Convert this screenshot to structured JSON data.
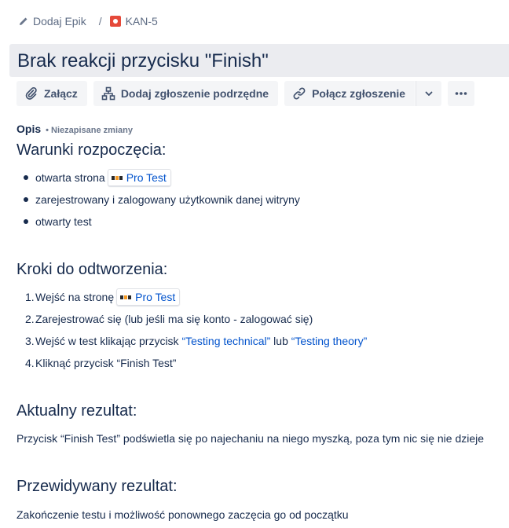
{
  "breadcrumb": {
    "epic_label": "Dodaj Epik",
    "separator": "/",
    "issue_key": "KAN-5"
  },
  "title": "Brak reakcji przycisku \"Finish\"",
  "toolbar": {
    "attach": "Załącz",
    "add_child": "Dodaj zgłoszenie podrzędne",
    "link_issue": "Połącz zgłoszenie"
  },
  "description": {
    "label": "Opis",
    "unsaved": "• Niezapisane zmiany",
    "preconditions": {
      "heading": "Warunki rozpoczęcia:",
      "items": [
        {
          "text": "otwarta strona",
          "link": "Pro Test"
        },
        {
          "text": "zarejestrowany i zalogowany użytkownik danej witryny"
        },
        {
          "text": "otwarty test"
        }
      ]
    },
    "steps": {
      "heading": "Kroki do odtworzenia:",
      "items": [
        {
          "num": "1.",
          "text": "Wejść na stronę",
          "link": "Pro Test"
        },
        {
          "num": "2.",
          "text": "Zarejestrować się (lub jeśli ma się konto - zalogować się)"
        },
        {
          "num": "3.",
          "text": "Wejść w test klikając przycisk ",
          "link1": "“Testing technical”",
          "mid": " lub ",
          "link2": "“Testing theory”"
        },
        {
          "num": "4.",
          "text": "Kliknąć przycisk “Finish Test”"
        }
      ]
    },
    "actual": {
      "heading": "Aktualny rezultat:",
      "text": "Przycisk “Finish Test” podświetla się po najechaniu na niego myszką, poza tym nic się nie dzieje"
    },
    "expected": {
      "heading": "Przewidywany rezultat:",
      "text": "Zakończenie testu i możliwość ponownego zaczęcia go od początku"
    }
  },
  "colors": {
    "link": "#0052cc",
    "text": "#172b4d",
    "bug": "#e5493a"
  }
}
